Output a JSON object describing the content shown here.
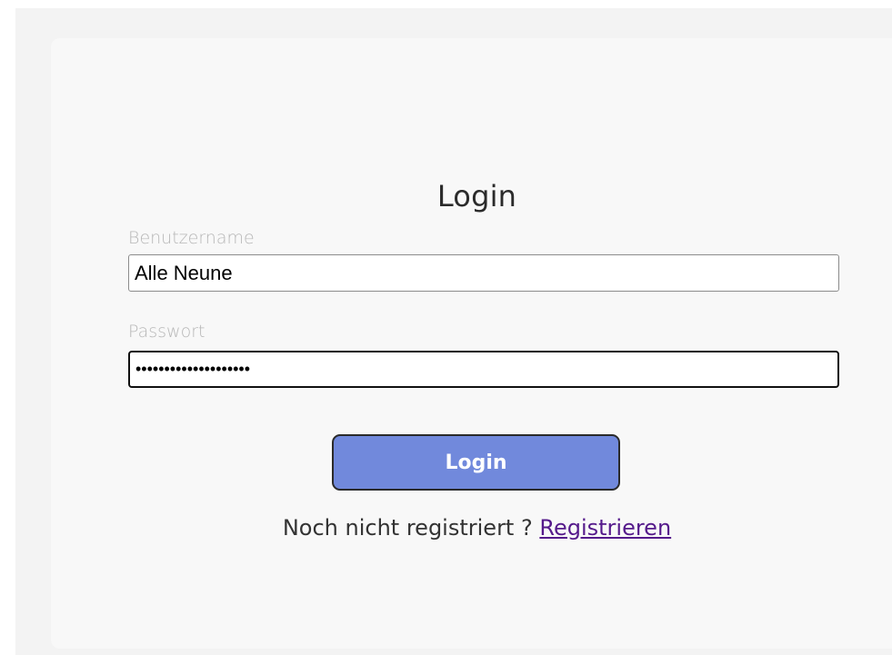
{
  "form": {
    "title": "Login",
    "username_label": "Benutzername",
    "username_value": "Alle Neune",
    "password_label": "Passwort",
    "password_value": "••••••••••••••••••••",
    "login_button": "Login",
    "register_prompt": "Noch nicht registriert ?",
    "register_link": "Registrieren"
  },
  "colors": {
    "accent": "#7189dc",
    "link": "#551a8b"
  }
}
